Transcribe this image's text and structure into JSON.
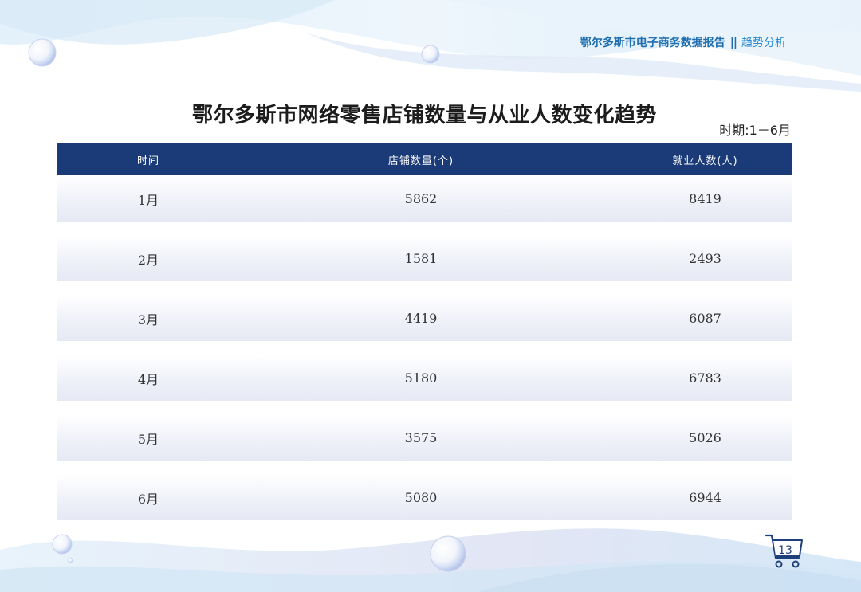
{
  "header": {
    "report_name": "鄂尔多斯市电子商务数据报告",
    "separator": "||",
    "section": "趋势分析"
  },
  "title": "鄂尔多斯市网络零售店铺数量与从业人数变化趋势",
  "period": "时期:1－6月",
  "table": {
    "columns": [
      "时间",
      "店铺数量(个)",
      "就业人数(人)"
    ],
    "rows": [
      {
        "month": "1月",
        "stores": "5862",
        "employees": "8419"
      },
      {
        "month": "2月",
        "stores": "1581",
        "employees": "2493"
      },
      {
        "month": "3月",
        "stores": "4419",
        "employees": "6087"
      },
      {
        "month": "4月",
        "stores": "5180",
        "employees": "6783"
      },
      {
        "month": "5月",
        "stores": "3575",
        "employees": "5026"
      },
      {
        "month": "6月",
        "stores": "5080",
        "employees": "6944"
      }
    ]
  },
  "page_number": "13",
  "icons": {
    "page_badge": "shopping-cart-icon",
    "decoration": "bubble-icon"
  },
  "colors": {
    "header_bar": "#1b3a78",
    "report_text": "#1f6fb0",
    "row_band": "#eef0f8"
  }
}
